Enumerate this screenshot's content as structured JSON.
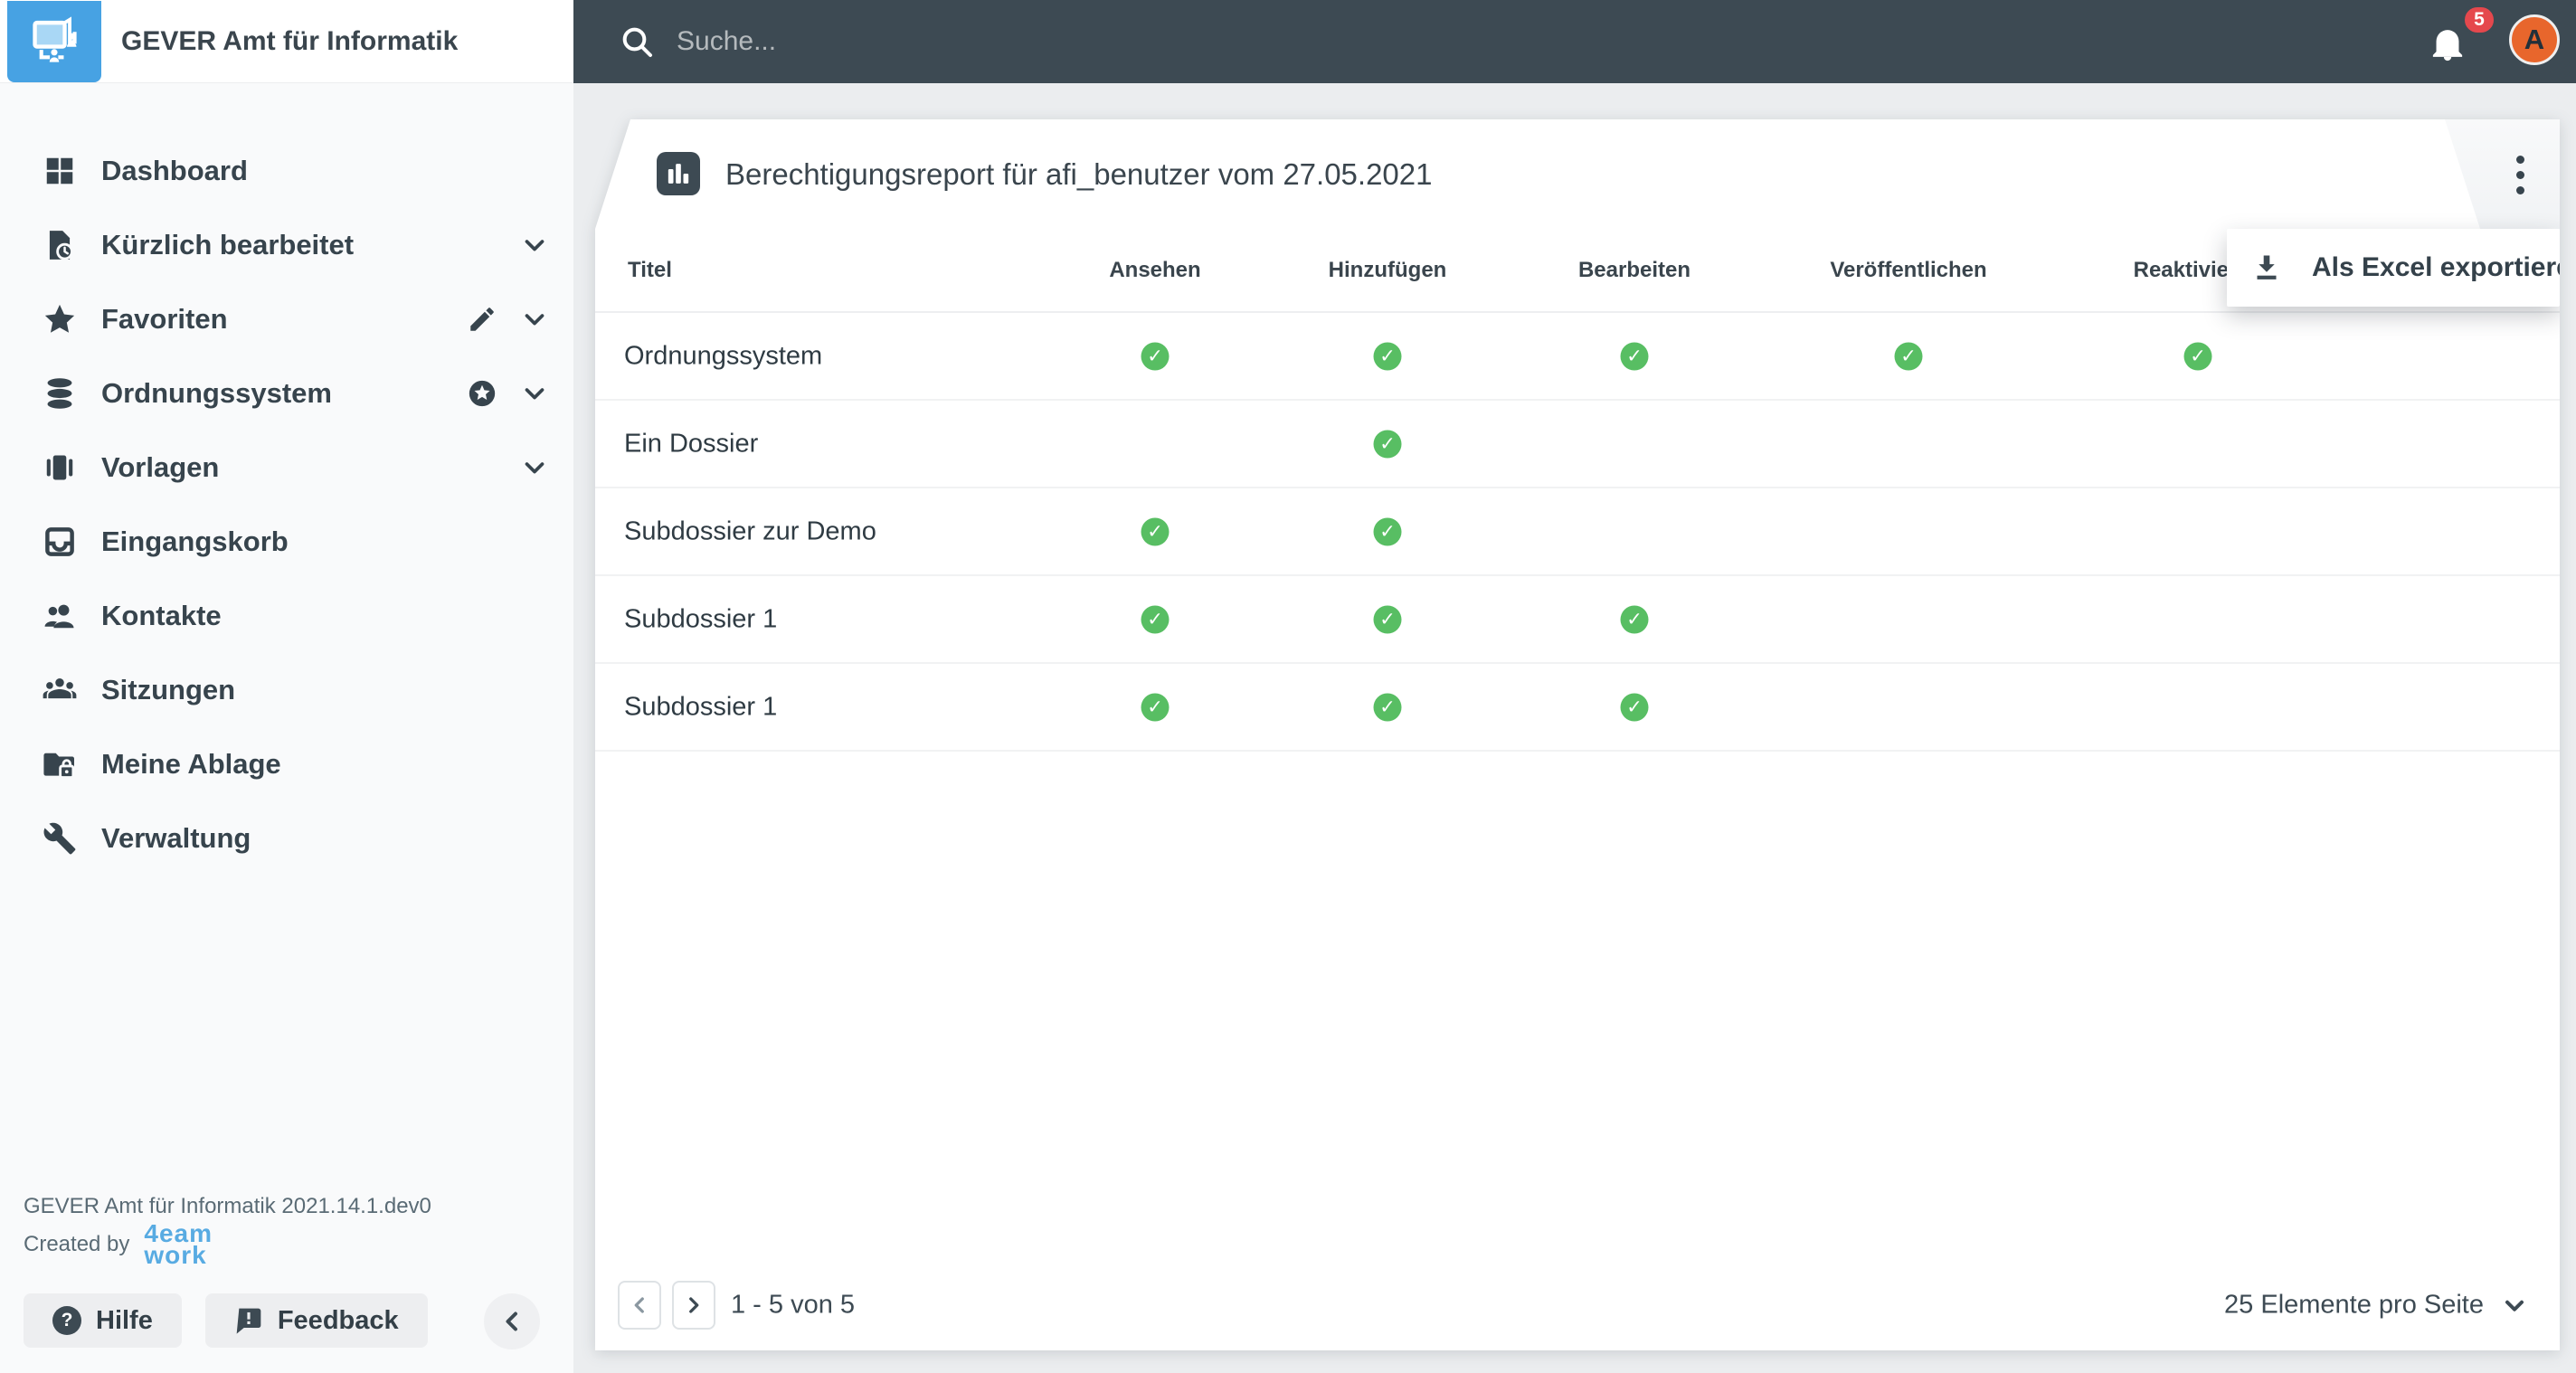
{
  "app": {
    "title": "GEVER Amt für Informatik",
    "version": "GEVER Amt für Informatik 2021.14.1.dev0",
    "created_by_label": "Created by",
    "vendor_logo_line1": "4eam",
    "vendor_logo_line2": "work"
  },
  "topbar": {
    "search_placeholder": "Suche...",
    "notifications": "5",
    "avatar": "A"
  },
  "sidebar": {
    "items": [
      {
        "label": "Dashboard"
      },
      {
        "label": "Kürzlich bearbeitet"
      },
      {
        "label": "Favoriten"
      },
      {
        "label": "Ordnungssystem"
      },
      {
        "label": "Vorlagen"
      },
      {
        "label": "Eingangskorb"
      },
      {
        "label": "Kontakte"
      },
      {
        "label": "Sitzungen"
      },
      {
        "label": "Meine Ablage"
      },
      {
        "label": "Verwaltung"
      }
    ],
    "help_label": "Hilfe",
    "feedback_label": "Feedback",
    "help_icon_glyph": "?"
  },
  "report": {
    "title": "Berechtigungsreport für afi_benutzer vom 27.05.2021"
  },
  "menu": {
    "export_label": "Als Excel exportieren"
  },
  "table": {
    "columns": [
      "Titel",
      "Ansehen",
      "Hinzufügen",
      "Bearbeiten",
      "Veröffentlichen",
      "Reaktivieren"
    ],
    "rows": [
      {
        "title": "Ordnungssystem",
        "perms": [
          true,
          true,
          true,
          true,
          true
        ]
      },
      {
        "title": "Ein Dossier",
        "perms": [
          false,
          true,
          false,
          false,
          false
        ]
      },
      {
        "title": "Subdossier zur Demo",
        "perms": [
          true,
          true,
          false,
          false,
          false
        ]
      },
      {
        "title": "Subdossier 1",
        "perms": [
          true,
          true,
          true,
          false,
          false
        ]
      },
      {
        "title": "Subdossier 1",
        "perms": [
          true,
          true,
          true,
          false,
          false
        ]
      }
    ]
  },
  "pagination": {
    "range": "1 - 5 von 5",
    "page_size": "25 Elemente pro Seite"
  },
  "colors": {
    "topbar": "#3D4A53",
    "accent_blue": "#47A2E3",
    "vendor_blue": "#58ABE2",
    "check_green": "#58BE63",
    "badge_red": "#E5484D",
    "avatar_orange": "#E8662C"
  }
}
